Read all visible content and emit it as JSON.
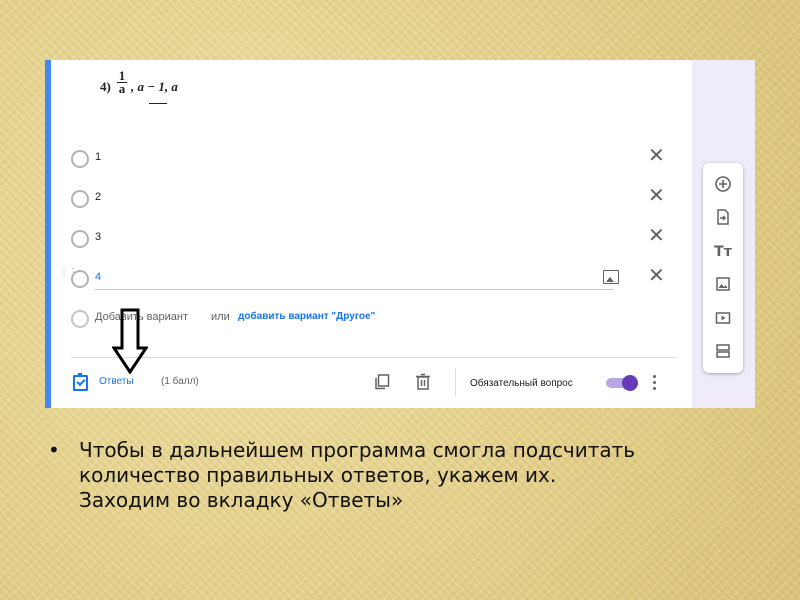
{
  "question": {
    "number_label": "4)",
    "fraction_numerator": "1",
    "fraction_denominator": "a",
    "expression_rest": ", a − 1, a"
  },
  "options": [
    {
      "label": "1"
    },
    {
      "label": "2"
    },
    {
      "label": "3"
    },
    {
      "label": "4"
    }
  ],
  "add_option": {
    "text": "Добавить вариант",
    "or_text": "или",
    "add_other_link": "добавить вариант \"Другое\""
  },
  "footer": {
    "answers_label": "Ответы",
    "points_label": "(1 балл)",
    "required_label": "Обязательный вопрос",
    "required_on": true
  },
  "side_toolbar": {
    "icons": [
      "add-question-icon",
      "import-questions-icon",
      "add-title-icon",
      "add-image-icon",
      "add-video-icon",
      "add-section-icon"
    ]
  },
  "slide": {
    "bullet": "•",
    "text": "Чтобы в дальнейшем программа смогла подсчитать\nколичество  правильных ответов, укажем их.\nЗаходим во вкладку «Ответы»"
  },
  "colors": {
    "accent": "#4285f4",
    "link": "#1a73e8",
    "toggle": "#673ab7",
    "background": "#e7d596"
  }
}
